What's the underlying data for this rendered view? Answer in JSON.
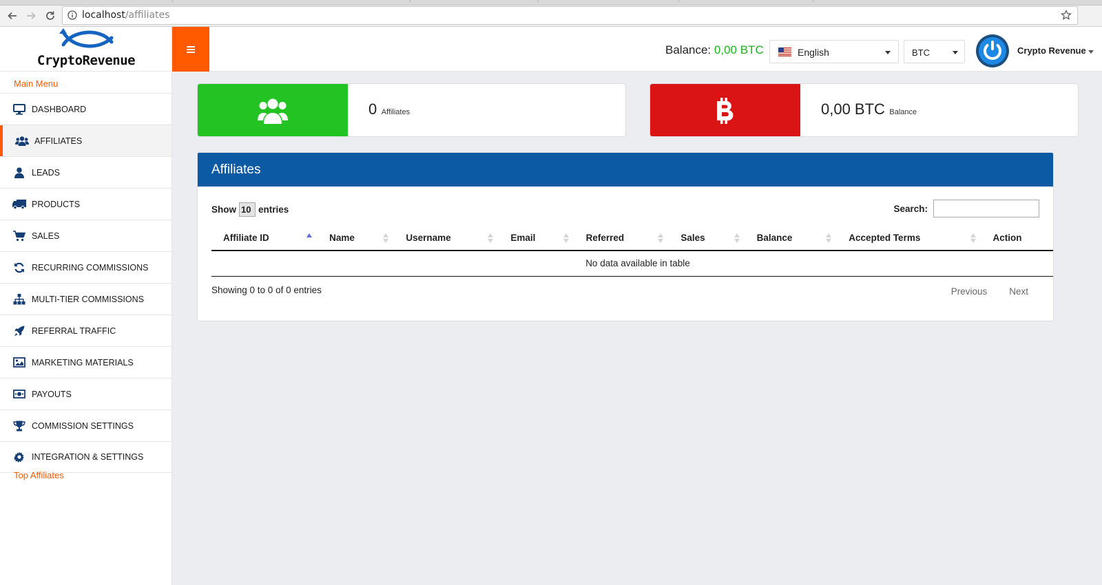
{
  "browser": {
    "url_host": "localhost",
    "url_path": "/affiliates"
  },
  "header": {
    "logo_text": "CryptoRevenue",
    "balance_label": "Balance:",
    "balance_value": "0,00 BTC",
    "language": "English",
    "currency": "BTC",
    "user_name": "Crypto Revenue"
  },
  "sidebar": {
    "section_main": "Main Menu",
    "section_top": "Top Affiliates",
    "items": [
      {
        "label": "DASHBOARD",
        "icon": "monitor-icon"
      },
      {
        "label": "AFFILIATES",
        "icon": "users-icon",
        "active": true
      },
      {
        "label": "LEADS",
        "icon": "user-icon"
      },
      {
        "label": "PRODUCTS",
        "icon": "truck-icon"
      },
      {
        "label": "SALES",
        "icon": "cart-icon"
      },
      {
        "label": "RECURRING COMMISSIONS",
        "icon": "refresh-icon"
      },
      {
        "label": "MULTI-TIER COMMISSIONS",
        "icon": "sitemap-icon"
      },
      {
        "label": "REFERRAL TRAFFIC",
        "icon": "rocket-icon"
      },
      {
        "label": "MARKETING MATERIALS",
        "icon": "image-icon"
      },
      {
        "label": "PAYOUTS",
        "icon": "money-icon"
      },
      {
        "label": "COMMISSION SETTINGS",
        "icon": "trophy-icon"
      },
      {
        "label": "INTEGRATION & SETTINGS",
        "icon": "gear-icon"
      }
    ]
  },
  "stats": {
    "affiliates": {
      "value": "0",
      "label": "Affiliates"
    },
    "balance": {
      "value": "0,00 BTC",
      "label": "Balance"
    }
  },
  "panel": {
    "title": "Affiliates",
    "show_label": "Show",
    "page_length": "10",
    "entries_label": "entries",
    "search_label": "Search:",
    "search_value": "",
    "columns": [
      "Affiliate ID",
      "Name",
      "Username",
      "Email",
      "Referred",
      "Sales",
      "Balance",
      "Accepted Terms",
      "Action"
    ],
    "empty_message": "No data available in table",
    "info": "Showing 0 to 0 of 0 entries",
    "prev_label": "Previous",
    "next_label": "Next"
  },
  "colors": {
    "accent_orange": "#ff5a00",
    "panel_blue": "#0d5aa4",
    "affiliates_green": "#22c322",
    "balance_red": "#da1414",
    "balance_text_green": "#1db41d"
  }
}
